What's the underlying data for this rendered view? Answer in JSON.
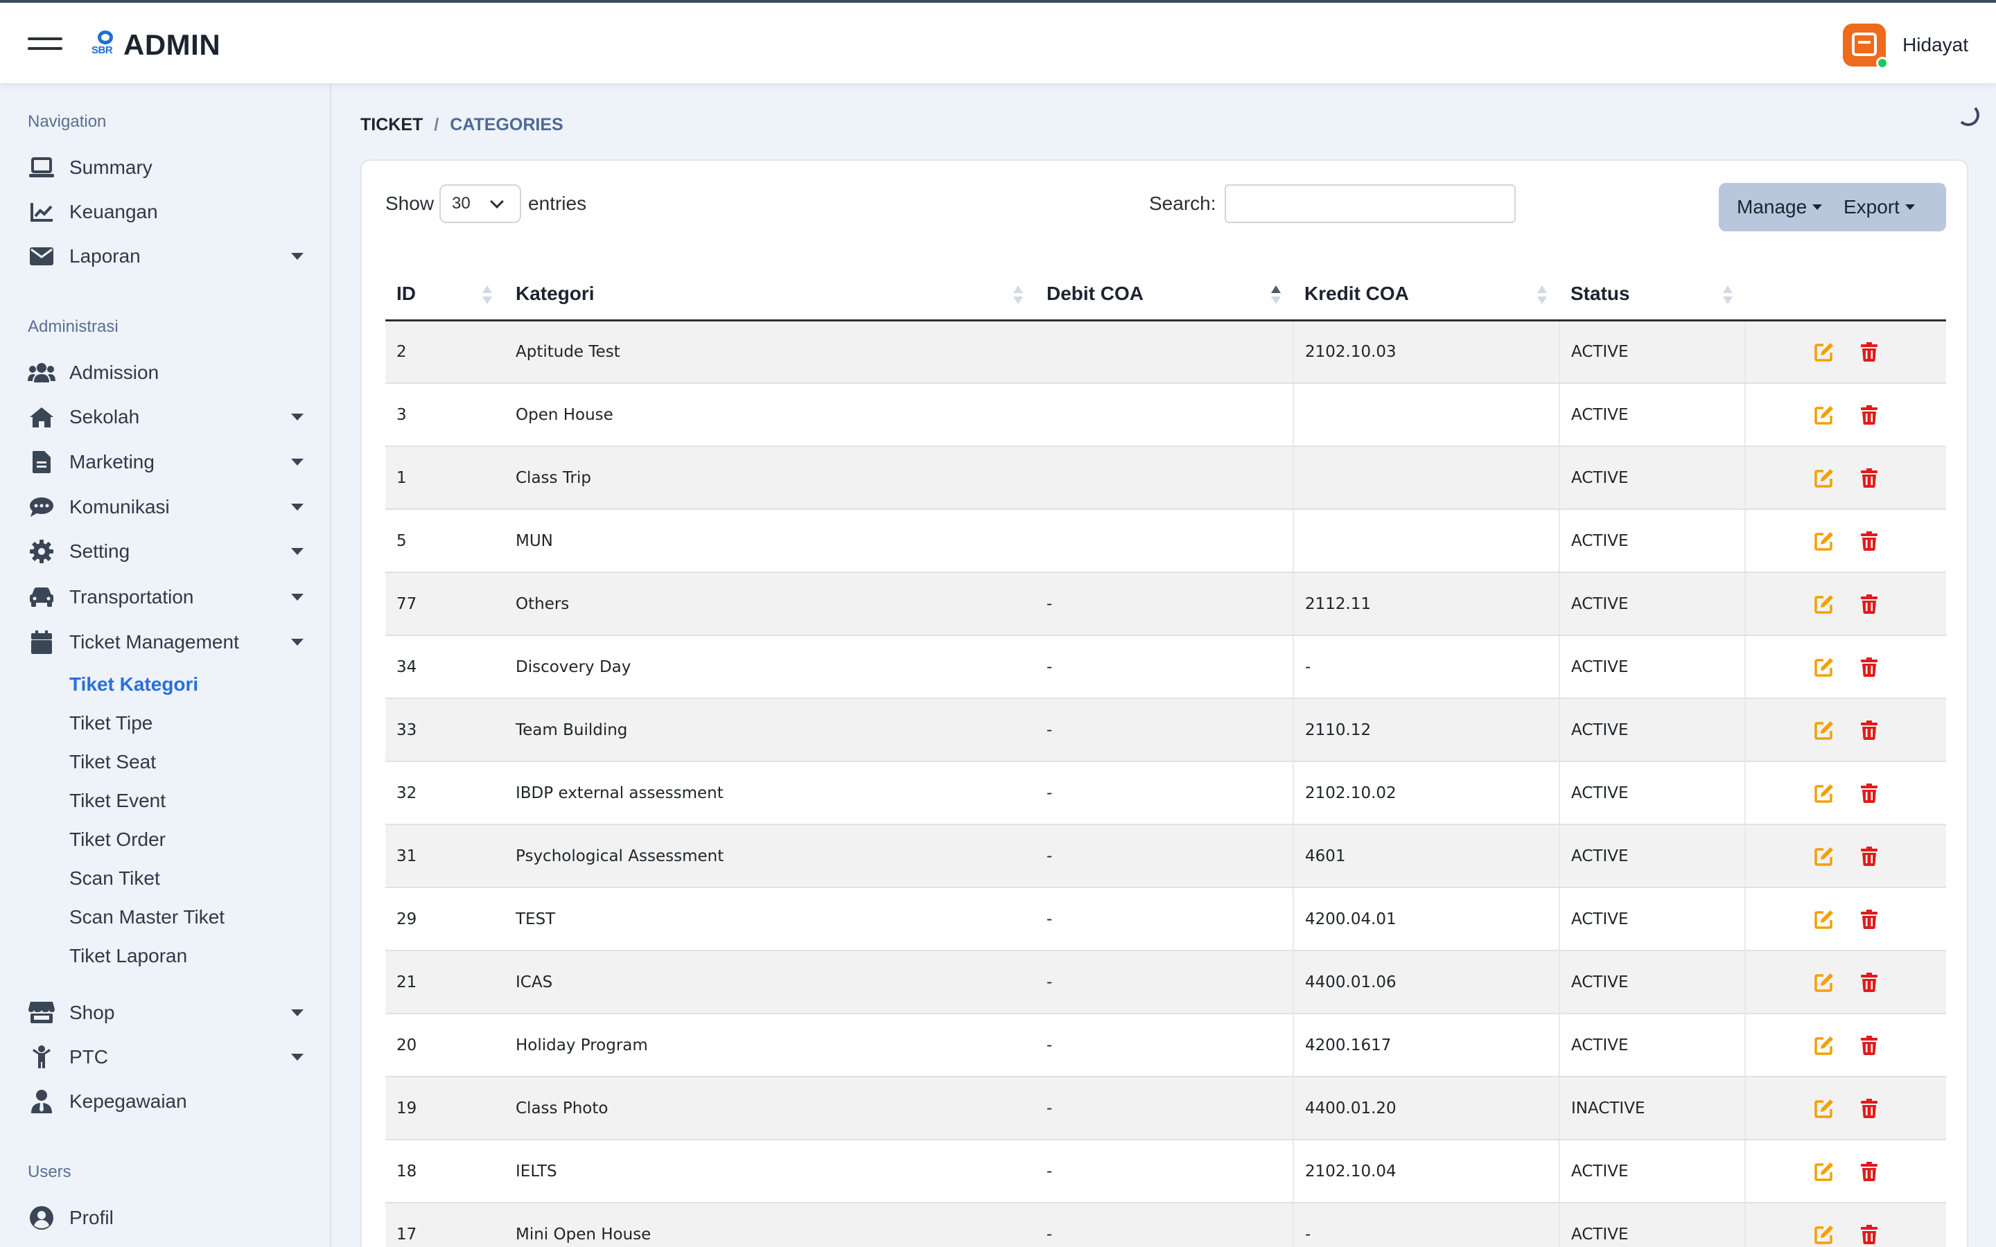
{
  "app": {
    "logo_mark": "SBR",
    "logo_text": "ADMIN",
    "user_name": "Hidayat"
  },
  "sidebar": {
    "sections": {
      "navigation": "Navigation",
      "administrasi": "Administrasi",
      "users": "Users"
    },
    "nav_items": [
      {
        "label": "Summary",
        "icon": "laptop-icon"
      },
      {
        "label": "Keuangan",
        "icon": "chart-line-icon"
      },
      {
        "label": "Laporan",
        "icon": "envelope-icon"
      }
    ],
    "admin_items": [
      {
        "label": "Admission",
        "icon": "users-icon"
      },
      {
        "label": "Sekolah",
        "icon": "home-icon"
      },
      {
        "label": "Marketing",
        "icon": "file-icon"
      },
      {
        "label": "Komunikasi",
        "icon": "comment-icon"
      },
      {
        "label": "Setting",
        "icon": "gear-icon"
      },
      {
        "label": "Transportation",
        "icon": "car-icon"
      },
      {
        "label": "Ticket Management",
        "icon": "calendar-icon"
      }
    ],
    "ticket_sub_items": [
      "Tiket Kategori",
      "Tiket Tipe",
      "Tiket Seat",
      "Tiket Event",
      "Tiket Order",
      "Scan Tiket",
      "Scan Master Tiket",
      "Tiket Laporan"
    ],
    "more_items": [
      {
        "label": "Shop",
        "icon": "store-icon"
      },
      {
        "label": "PTC",
        "icon": "child-icon"
      },
      {
        "label": "Kepegawaian",
        "icon": "user-tie-icon"
      }
    ],
    "user_items": [
      {
        "label": "Profil",
        "icon": "user-circle-icon"
      }
    ]
  },
  "breadcrumb": {
    "root": "TICKET",
    "separator": "/",
    "current": "CATEGORIES"
  },
  "controls": {
    "show_label": "Show",
    "entries_value": "30",
    "entries_label": "entries",
    "search_label": "Search:",
    "search_value": "",
    "manage_label": "Manage",
    "export_label": "Export"
  },
  "table": {
    "columns": [
      "ID",
      "Kategori",
      "Debit COA",
      "Kredit COA",
      "Status"
    ],
    "rows": [
      [
        "2",
        "Aptitude Test",
        "",
        "2102.10.03",
        "ACTIVE"
      ],
      [
        "3",
        "Open House",
        "",
        "",
        "ACTIVE"
      ],
      [
        "1",
        "Class Trip",
        "",
        "",
        "ACTIVE"
      ],
      [
        "5",
        "MUN",
        "",
        "",
        "ACTIVE"
      ],
      [
        "77",
        "Others",
        "-",
        "2112.11",
        "ACTIVE"
      ],
      [
        "34",
        "Discovery Day",
        "-",
        "-",
        "ACTIVE"
      ],
      [
        "33",
        "Team Building",
        "-",
        "2110.12",
        "ACTIVE"
      ],
      [
        "32",
        "IBDP external assessment",
        "-",
        "2102.10.02",
        "ACTIVE"
      ],
      [
        "31",
        "Psychological Assessment",
        "-",
        "4601",
        "ACTIVE"
      ],
      [
        "29",
        "TEST",
        "-",
        "4200.04.01",
        "ACTIVE"
      ],
      [
        "21",
        "ICAS",
        "-",
        "4400.01.06",
        "ACTIVE"
      ],
      [
        "20",
        "Holiday Program",
        "-",
        "4200.1617",
        "ACTIVE"
      ],
      [
        "19",
        "Class Photo",
        "-",
        "4400.01.20",
        "INACTIVE"
      ],
      [
        "18",
        "IELTS",
        "-",
        "2102.10.04",
        "ACTIVE"
      ],
      [
        "17",
        "Mini Open House",
        "-",
        "-",
        "ACTIVE"
      ]
    ]
  },
  "colors": {
    "accent": "#2a6fd8",
    "edit": "#f59f00",
    "delete": "#e21b1b",
    "brand": "#ee6a1c"
  }
}
